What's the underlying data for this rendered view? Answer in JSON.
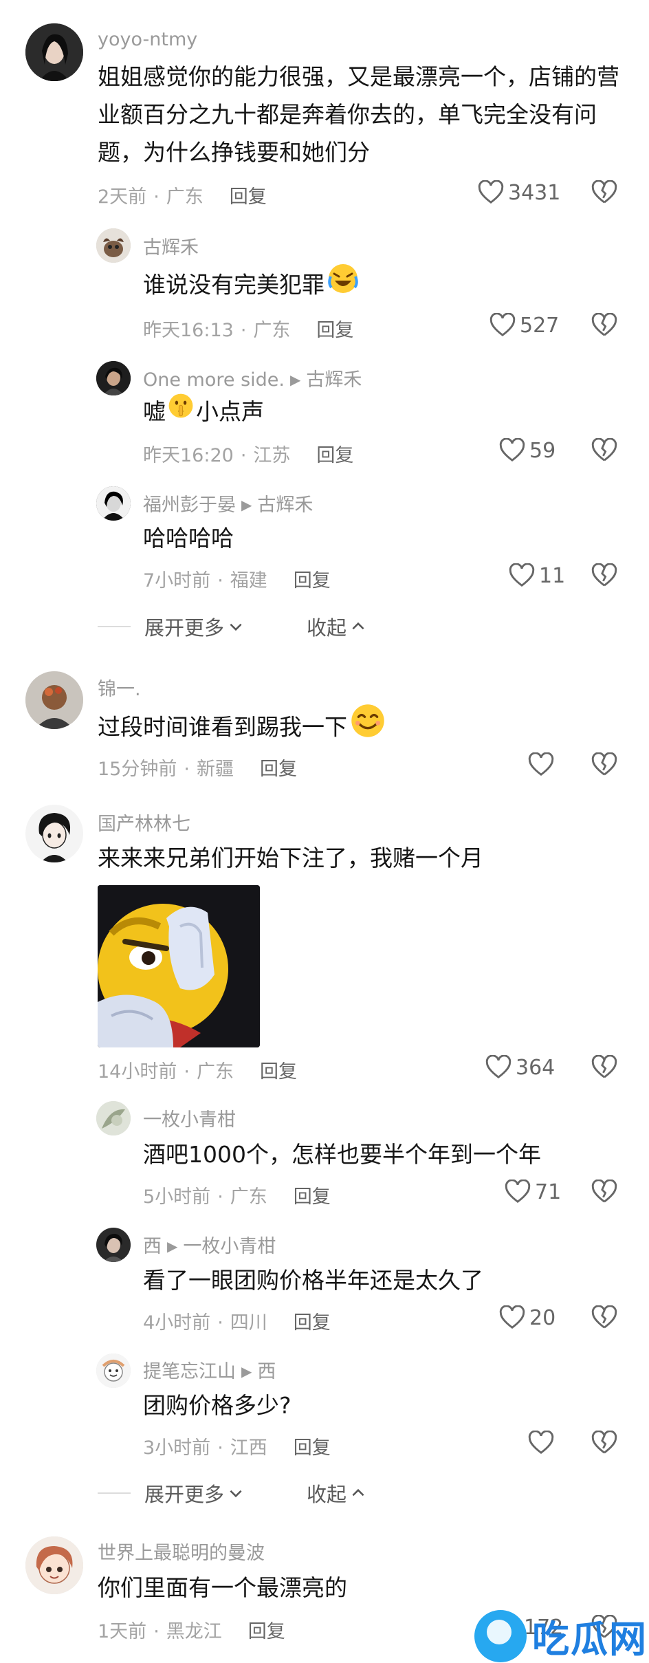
{
  "comments": [
    {
      "user": "yoyo-ntmy",
      "text": "姐姐感觉你的能力很强，又是最漂亮一个，店铺的营业额百分之九十都是奔着你去的，单飞完全没有问题，为什么挣钱要和她们分",
      "time": "2天前",
      "region": "广东",
      "reply": "回复",
      "likes": "3431",
      "replies": [
        {
          "user": "古辉禾",
          "target": "",
          "text": "谁说没有完美犯罪",
          "emoji": "laughing-crying-emoji",
          "time": "昨天16:13",
          "region": "广东",
          "reply": "回复",
          "likes": "527"
        },
        {
          "user": "One more side.",
          "target": "古辉禾",
          "text_before": "嘘",
          "emoji": "shushing-emoji",
          "text_after": "小点声",
          "time": "昨天16:20",
          "region": "江苏",
          "reply": "回复",
          "likes": "59"
        },
        {
          "user": "福州彭于晏",
          "target": "古辉禾",
          "text": "哈哈哈哈",
          "time": "7小时前",
          "region": "福建",
          "reply": "回复",
          "likes": "11"
        }
      ],
      "expand": "展开更多",
      "collapse": "收起"
    },
    {
      "user": "锦一.",
      "text": "过段时间谁看到踢我一下",
      "emoji": "smiling-emoji",
      "time": "15分钟前",
      "region": "新疆",
      "reply": "回复",
      "likes": ""
    },
    {
      "user": "国产林林七",
      "text": "来来来兄弟们开始下注了，我赌一个月",
      "image": "emoji-meme-image",
      "time": "14小时前",
      "region": "广东",
      "reply": "回复",
      "likes": "364",
      "replies": [
        {
          "user": "一枚小青柑",
          "target": "",
          "text": "酒吧1000个，怎样也要半个年到一个年",
          "time": "5小时前",
          "region": "广东",
          "reply": "回复",
          "likes": "71"
        },
        {
          "user": "西",
          "target": "一枚小青柑",
          "text": "看了一眼团购价格半年还是太久了",
          "time": "4小时前",
          "region": "四川",
          "reply": "回复",
          "likes": "20"
        },
        {
          "user": "提笔忘江山",
          "target": "西",
          "text": "团购价格多少?",
          "time": "3小时前",
          "region": "江西",
          "reply": "回复",
          "likes": ""
        }
      ],
      "expand": "展开更多",
      "collapse": "收起"
    },
    {
      "user": "世界上最聪明的曼波",
      "text": "你们里面有一个最漂亮的",
      "time": "1天前",
      "region": "黑龙江",
      "reply": "回复",
      "likes": "172"
    }
  ],
  "watermark": "吃瓜网",
  "colors": {
    "meta": "#a3a3a3",
    "username": "#9a9a9a",
    "text": "#161616",
    "watermark": "#1f7fe0"
  }
}
